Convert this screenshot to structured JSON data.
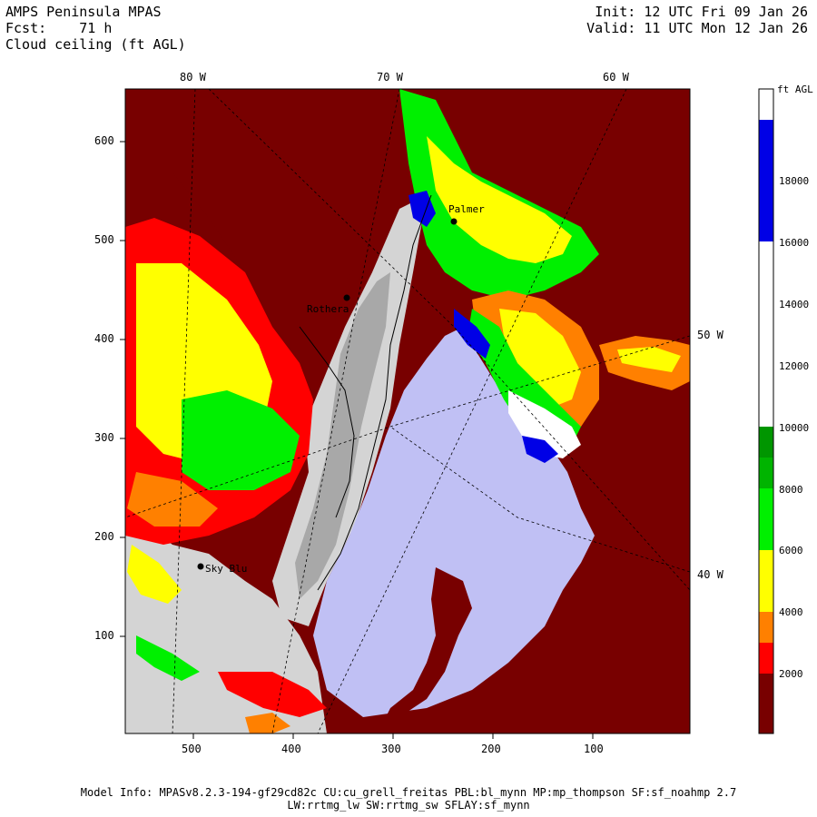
{
  "header": {
    "title": "AMPS Peninsula MPAS",
    "forecast": "Fcst:    71 h",
    "field": "Cloud ceiling (ft AGL)",
    "init": "Init: 12 UTC Fri 09 Jan 26",
    "valid": "Valid: 11 UTC Mon 12 Jan 26"
  },
  "axes": {
    "x_ticks": [
      "500",
      "400",
      "300",
      "200",
      "100"
    ],
    "y_ticks": [
      "600",
      "500",
      "400",
      "300",
      "200",
      "100"
    ],
    "lon_top": [
      "80 W",
      "70 W",
      "60 W"
    ],
    "lon_right": [
      "50 W",
      "40 W"
    ]
  },
  "stations": [
    "Palmer",
    "Rothera",
    "Sky Blu"
  ],
  "colorbar": {
    "unit": "ft AGL",
    "labels": [
      "18000",
      "16000",
      "14000",
      "12000",
      "10000",
      "8000",
      "6000",
      "4000",
      "2000"
    ],
    "colors": {
      "white": "#ffffff",
      "blue": "#0000e6",
      "green_dark": "#009600",
      "green_mid": "#00b400",
      "green": "#00f000",
      "yellow": "#ffff00",
      "orange": "#ff8000",
      "red": "#ff0000",
      "dark_red": "#780000"
    }
  },
  "map_colors": {
    "sea_ice": "#c0c0f4",
    "land_ice": "#d4d4d4",
    "terrain_shade": "#a0a0a0"
  },
  "footer": {
    "line1": "Model Info: MPASv8.2.3-194-gf29cd82c CU:cu_grell_freitas PBL:bl_mynn MP:mp_thompson SF:sf_noahmp 2.7",
    "line2": "LW:rrtmg_lw SW:rrtmg_sw SFLAY:sf_mynn"
  }
}
